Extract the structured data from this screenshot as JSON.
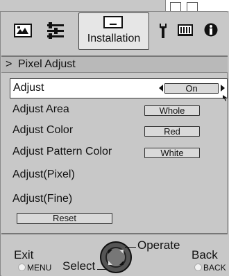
{
  "tabs": {
    "picture_icon": "picture-icon",
    "settings_icon": "sliders-icon",
    "installation_label": "Installation",
    "wrench_icon": "wrench-icon",
    "grid_icon": "grid-icon",
    "info_icon": "info-icon"
  },
  "section": {
    "arrow": ">",
    "title": "Pixel Adjust"
  },
  "rows": [
    {
      "label": "Adjust",
      "value": "On"
    },
    {
      "label": "Adjust Area",
      "value": "Whole"
    },
    {
      "label": "Adjust Color",
      "value": "Red"
    },
    {
      "label": "Adjust Pattern Color",
      "value": "White"
    },
    {
      "label": "Adjust(Pixel)"
    },
    {
      "label": "Adjust(Fine)"
    }
  ],
  "reset_label": "Reset",
  "footer": {
    "exit": "Exit",
    "menu": "MENU",
    "select": "Select",
    "operate": "Operate",
    "back": "Back",
    "back_key": "BACK"
  },
  "colors": {
    "osd_bg": "#c8c8c8",
    "highlight": "#ffffff",
    "border": "#333333"
  }
}
